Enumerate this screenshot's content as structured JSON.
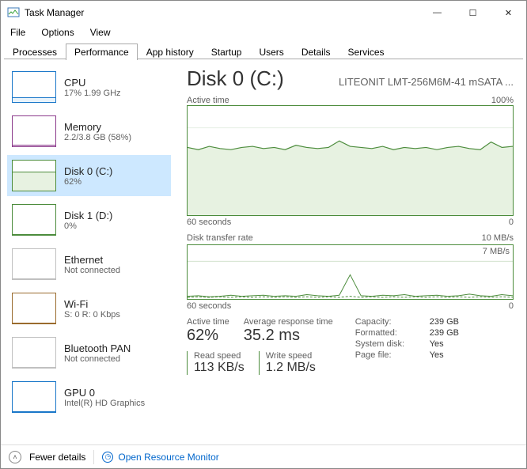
{
  "window": {
    "title": "Task Manager",
    "min": "—",
    "max": "☐",
    "close": "✕"
  },
  "menu": [
    "File",
    "Options",
    "View"
  ],
  "tabs": [
    "Processes",
    "Performance",
    "App history",
    "Startup",
    "Users",
    "Details",
    "Services"
  ],
  "active_tab_index": 1,
  "sidebar": [
    {
      "title": "CPU",
      "sub": "17% 1.99 GHz",
      "color": "#1a77c9",
      "fill": "#e8f3fb",
      "level": 0.17
    },
    {
      "title": "Memory",
      "sub": "2.2/3.8 GB (58%)",
      "color": "#8b3a8b",
      "fill": "#f3e7f3",
      "level": 0.05
    },
    {
      "title": "Disk 0 (C:)",
      "sub": "62%",
      "color": "#4c8c3c",
      "fill": "#e7f2e1",
      "level": 0.62,
      "selected": true
    },
    {
      "title": "Disk 1 (D:)",
      "sub": "0%",
      "color": "#4c8c3c",
      "fill": "#e7f2e1",
      "level": 0.0
    },
    {
      "title": "Ethernet",
      "sub": "Not connected",
      "color": "#c0c0c0",
      "fill": "#f4f4f4",
      "level": 0.0
    },
    {
      "title": "Wi-Fi",
      "sub": "S: 0 R: 0 Kbps",
      "color": "#9a6b2d",
      "fill": "#f5efe5",
      "level": 0.0
    },
    {
      "title": "Bluetooth PAN",
      "sub": "Not connected",
      "color": "#c0c0c0",
      "fill": "#f4f4f4",
      "level": 0.0
    },
    {
      "title": "GPU 0",
      "sub": "Intel(R) HD Graphics",
      "color": "#1a77c9",
      "fill": "#e8f3fb",
      "level": 0.0
    }
  ],
  "detail": {
    "title": "Disk 0 (C:)",
    "model": "LITEONIT LMT-256M6M-41 mSATA ...",
    "color": "#4c8c3c",
    "fill": "#e7f2e1",
    "chart1": {
      "label_left": "Active time",
      "label_right": "100%",
      "x_left": "60 seconds",
      "x_right": "0"
    },
    "chart2": {
      "label_left": "Disk transfer rate",
      "label_right": "10 MB/s",
      "inner_right": "7 MB/s",
      "x_left": "60 seconds",
      "x_right": "0"
    },
    "stats": {
      "active_time_label": "Active time",
      "active_time_value": "62%",
      "avg_resp_label": "Average response time",
      "avg_resp_value": "35.2 ms",
      "read_label": "Read speed",
      "read_value": "113 KB/s",
      "write_label": "Write speed",
      "write_value": "1.2 MB/s",
      "kv": [
        {
          "k": "Capacity:",
          "v": "239 GB"
        },
        {
          "k": "Formatted:",
          "v": "239 GB"
        },
        {
          "k": "System disk:",
          "v": "Yes"
        },
        {
          "k": "Page file:",
          "v": "Yes"
        }
      ]
    }
  },
  "footer": {
    "fewer": "Fewer details",
    "resmon": "Open Resource Monitor"
  },
  "chart_data": [
    {
      "type": "area",
      "title": "Active time",
      "ylabel": "%",
      "xlabel": "seconds",
      "ylim": [
        0,
        100
      ],
      "x": [
        60,
        58,
        56,
        54,
        52,
        50,
        48,
        46,
        44,
        42,
        40,
        38,
        36,
        34,
        32,
        30,
        28,
        26,
        24,
        22,
        20,
        18,
        16,
        14,
        12,
        10,
        8,
        6,
        4,
        2,
        0
      ],
      "values": [
        62,
        60,
        63,
        61,
        60,
        62,
        63,
        61,
        62,
        60,
        64,
        62,
        61,
        62,
        68,
        63,
        62,
        61,
        63,
        60,
        62,
        61,
        62,
        60,
        62,
        63,
        61,
        60,
        67,
        62,
        63
      ]
    },
    {
      "type": "line",
      "title": "Disk transfer rate",
      "ylabel": "MB/s",
      "xlabel": "seconds",
      "ylim": [
        0,
        10
      ],
      "series": [
        {
          "name": "Read",
          "values": [
            0.5,
            0.6,
            0.4,
            0.5,
            0.7,
            0.5,
            0.6,
            0.7,
            0.5,
            0.6,
            0.5,
            0.8,
            0.6,
            0.5,
            0.7,
            4.5,
            0.6,
            0.5,
            0.7,
            0.6,
            0.8,
            0.5,
            0.6,
            0.7,
            0.5,
            0.6,
            0.9,
            0.6,
            0.5,
            0.8,
            0.6
          ]
        },
        {
          "name": "Write",
          "values": [
            0.3,
            0.4,
            0.3,
            0.4,
            0.3,
            0.4,
            0.3,
            0.4,
            0.3,
            0.4,
            0.3,
            0.4,
            0.3,
            0.4,
            0.3,
            0.5,
            0.3,
            0.4,
            0.3,
            0.4,
            0.3,
            0.4,
            0.3,
            0.4,
            0.3,
            0.4,
            0.3,
            0.4,
            0.3,
            0.4,
            0.3
          ]
        }
      ],
      "x": [
        60,
        58,
        56,
        54,
        52,
        50,
        48,
        46,
        44,
        42,
        40,
        38,
        36,
        34,
        32,
        30,
        28,
        26,
        24,
        22,
        20,
        18,
        16,
        14,
        12,
        10,
        8,
        6,
        4,
        2,
        0
      ]
    }
  ]
}
